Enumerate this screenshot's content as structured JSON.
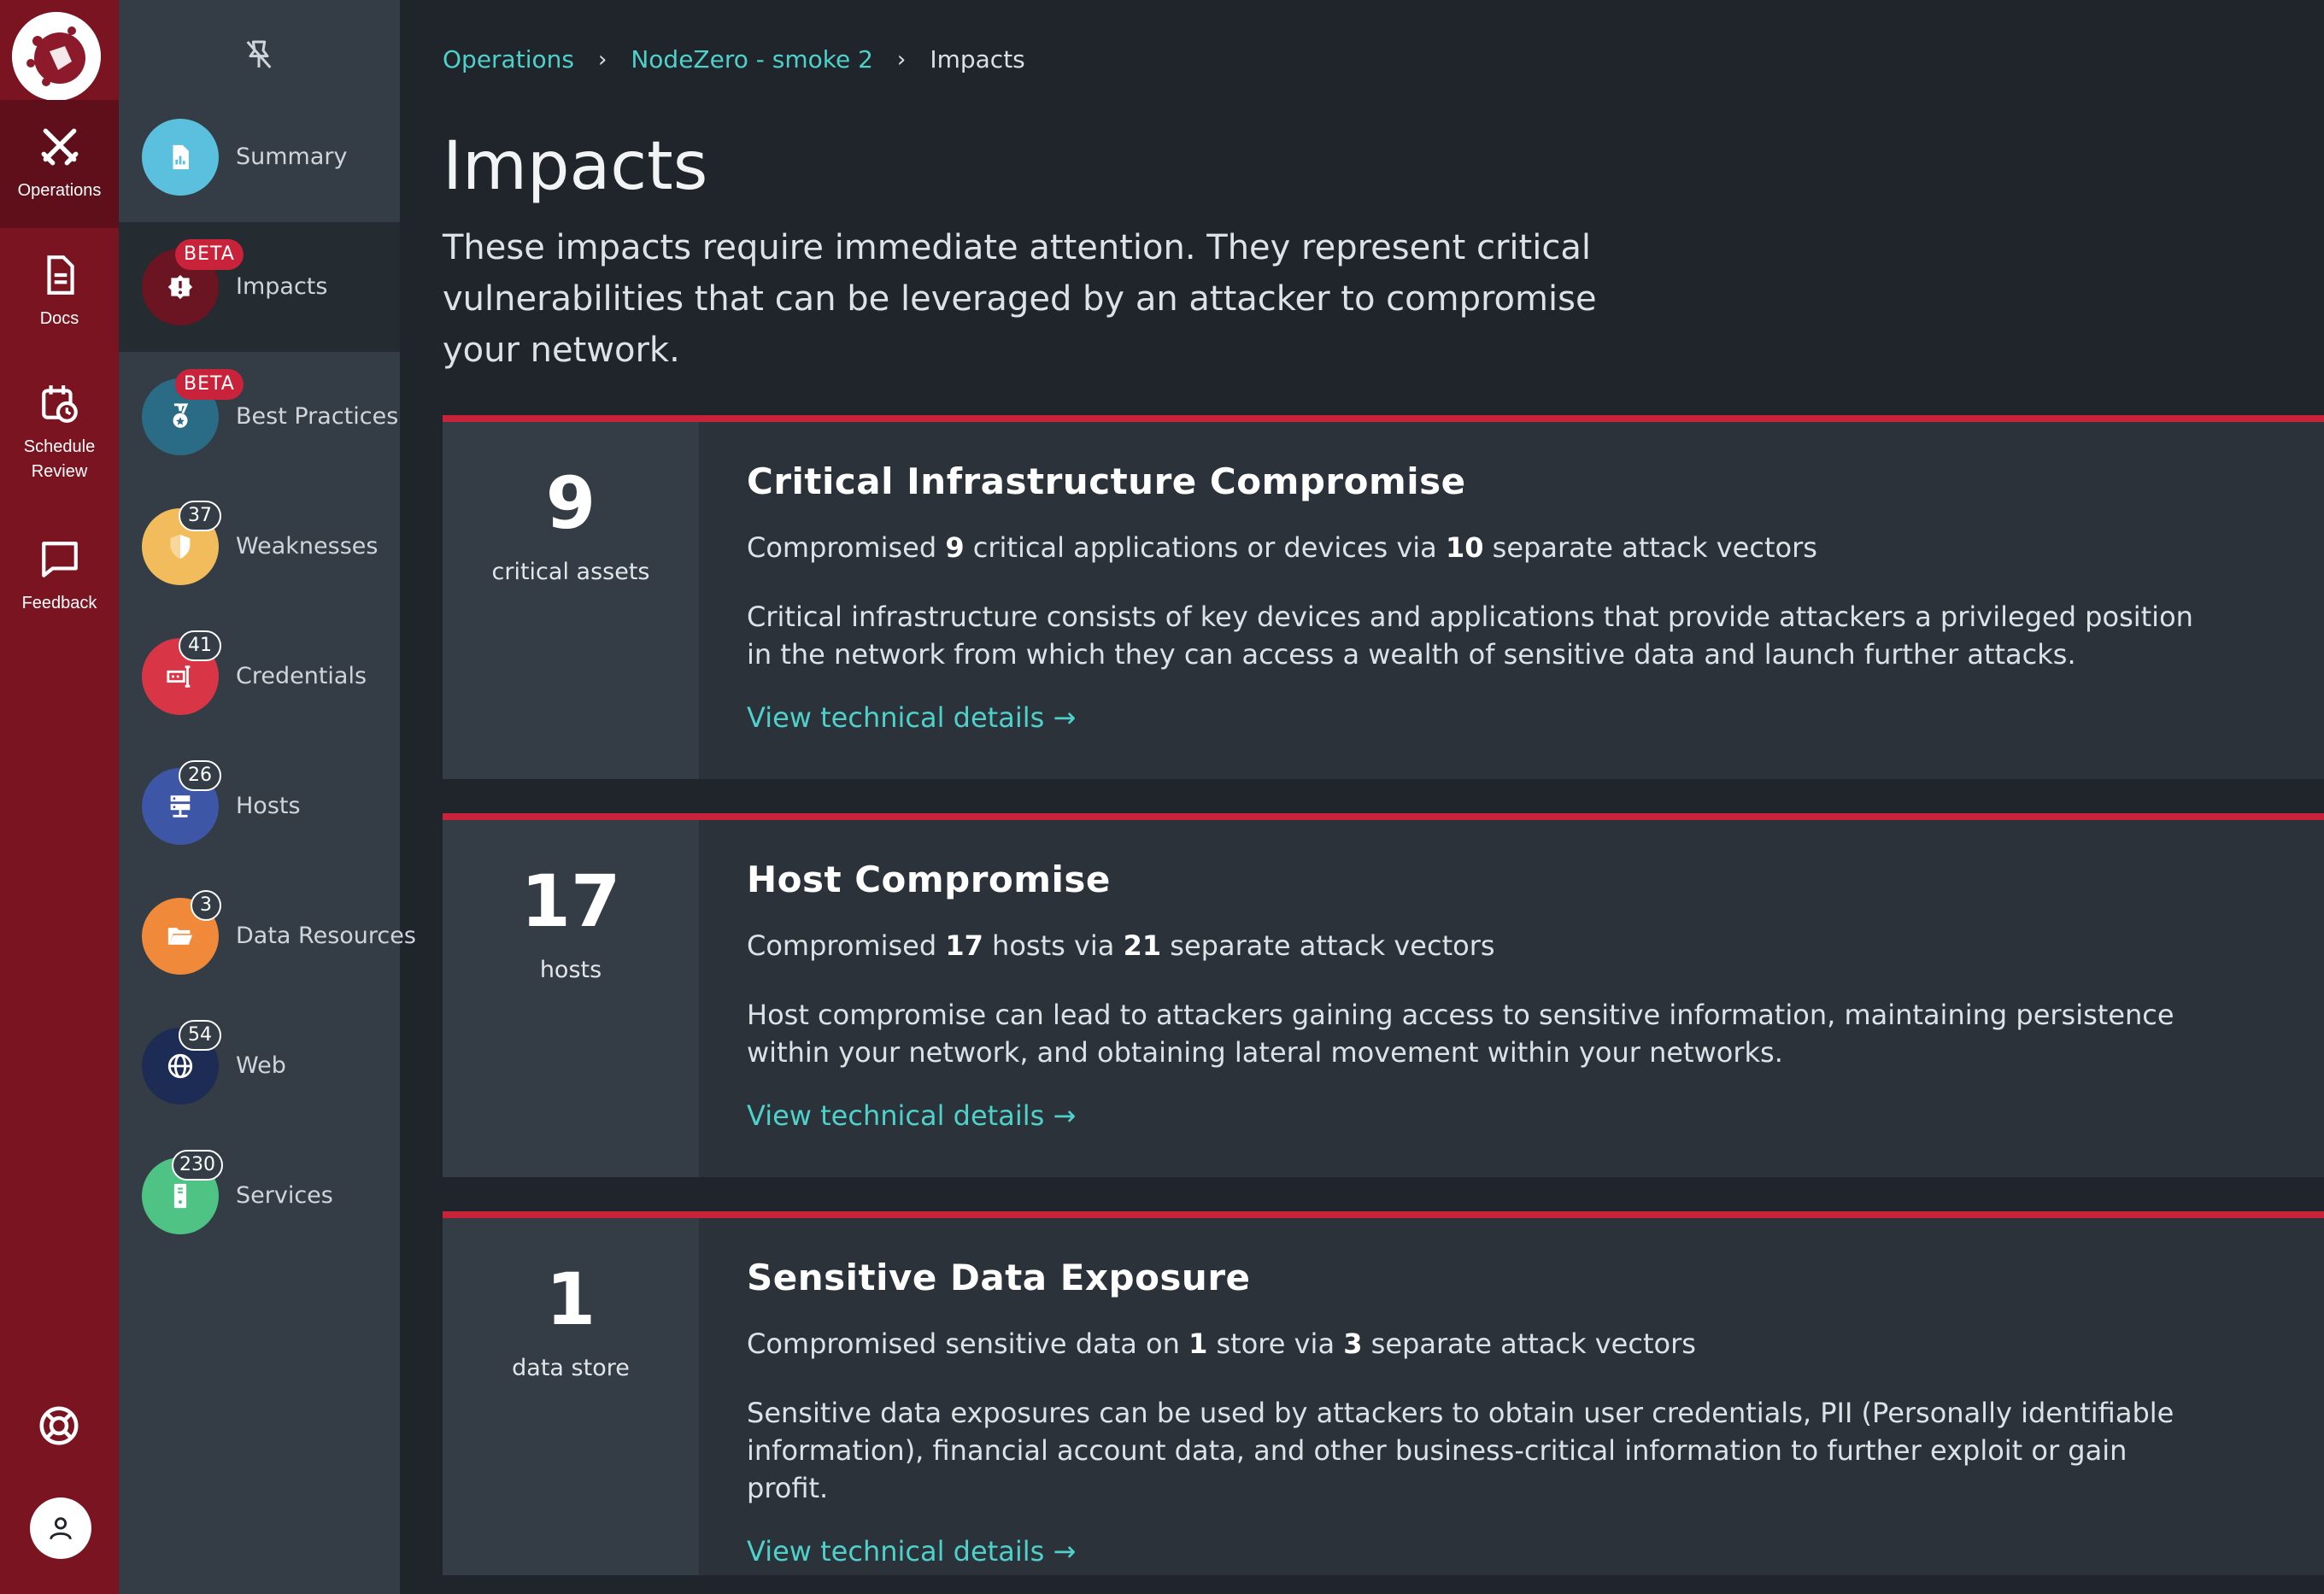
{
  "rail": {
    "items": [
      {
        "label": "Operations",
        "icon": "crossed-swords-icon"
      },
      {
        "label": "Docs",
        "icon": "document-icon"
      },
      {
        "label": "Schedule Review",
        "icon": "calendar-clock-icon"
      },
      {
        "label": "Feedback",
        "icon": "chat-bubble-icon"
      }
    ],
    "help_icon": "lifebuoy-icon",
    "user_icon": "user-icon"
  },
  "subnav": {
    "pin_icon": "pin-off-icon",
    "items": [
      {
        "label": "Summary",
        "color": "#5bc0de"
      },
      {
        "label": "Impacts",
        "badge": "BETA",
        "color": "#6b1422"
      },
      {
        "label": "Best Practices",
        "badge": "BETA",
        "color": "#2a6b86"
      },
      {
        "label": "Weaknesses",
        "count": "37",
        "color": "#f2bc5c"
      },
      {
        "label": "Credentials",
        "count": "41",
        "color": "#d83546"
      },
      {
        "label": "Hosts",
        "count": "26",
        "color": "#3d56a6"
      },
      {
        "label": "Data Resources",
        "count": "3",
        "color": "#f08a3a"
      },
      {
        "label": "Web",
        "count": "54",
        "color": "#1d2c55"
      },
      {
        "label": "Services",
        "count": "230",
        "color": "#4fc384"
      }
    ]
  },
  "breadcrumb": {
    "items": [
      "Operations",
      "NodeZero - smoke 2"
    ],
    "current": "Impacts",
    "separator": "›"
  },
  "page": {
    "title": "Impacts",
    "description": "These impacts require immediate attention. They represent critical vulnerabilities that can be leveraged by an attacker to compromise your network."
  },
  "cards": [
    {
      "stat": "9",
      "unit": "critical assets",
      "title": "Critical Infrastructure Compromise",
      "summary_pre": "Compromised ",
      "summary_n1": "9",
      "summary_mid": " critical applications or devices via ",
      "summary_n2": "10",
      "summary_post": " separate attack vectors",
      "text": "Critical infrastructure consists of key devices and applications that provide attackers a privileged position in the network from which they can access a wealth of sensitive data and launch further attacks.",
      "link": "View technical details →"
    },
    {
      "stat": "17",
      "unit": "hosts",
      "title": "Host Compromise",
      "summary_pre": "Compromised ",
      "summary_n1": "17",
      "summary_mid": " hosts via ",
      "summary_n2": "21",
      "summary_post": " separate attack vectors",
      "text": "Host compromise can lead to attackers gaining access to sensitive information, maintaining persistence within your network, and obtaining lateral movement within your networks.",
      "link": "View technical details →"
    },
    {
      "stat": "1",
      "unit": "data store",
      "title": "Sensitive Data Exposure",
      "summary_pre": "Compromised sensitive data on ",
      "summary_n1": "1",
      "summary_mid": " store via ",
      "summary_n2": "3",
      "summary_post": " separate attack vectors",
      "text": "Sensitive data exposures can be used by attackers to obtain user credentials, PII (Personally identifiable information), financial account data, and other business-critical information to further exploit or gain profit.",
      "link": "View technical details →"
    }
  ],
  "colors": {
    "accent": "#4fd1cb",
    "brand": "#7a1421",
    "alert": "#c8233a"
  }
}
